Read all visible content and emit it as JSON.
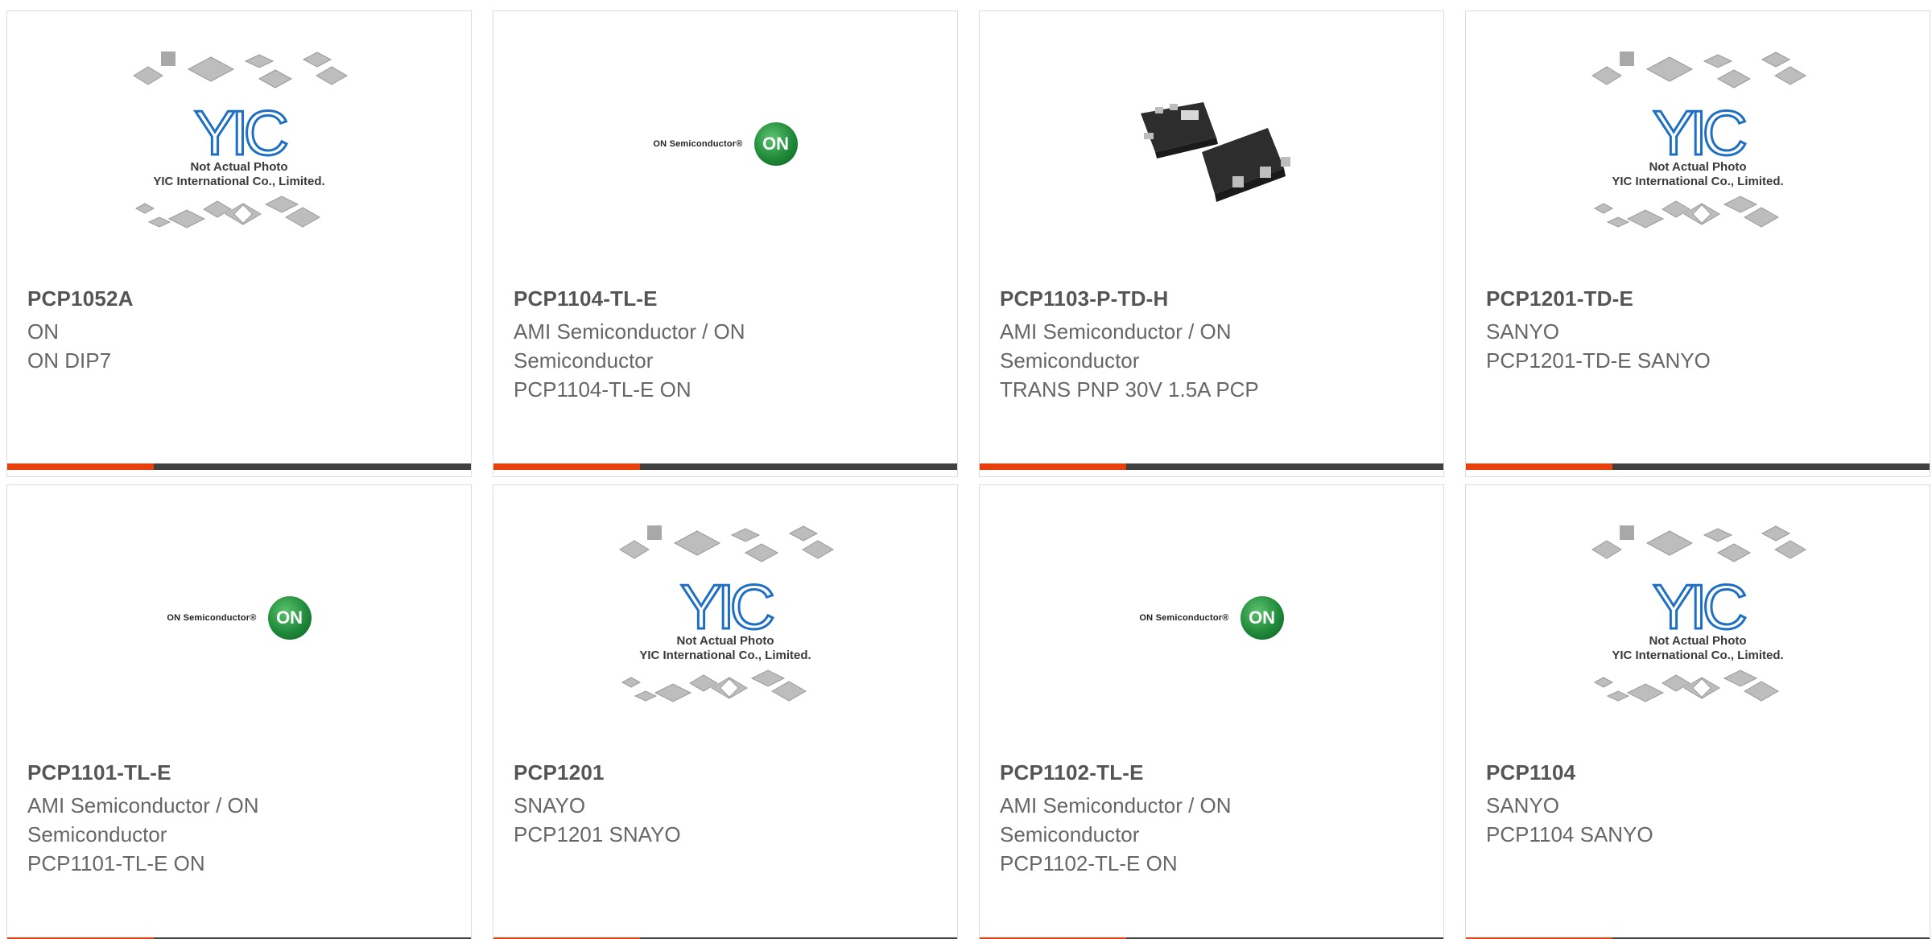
{
  "products": [
    {
      "part": "PCP1052A",
      "manufacturer": "ON",
      "description": "ON DIP7",
      "image": "yic-placeholder-icon"
    },
    {
      "part": "PCP1104-TL-E",
      "manufacturer": "AMI Semiconductor / ON Semiconductor",
      "description": "PCP1104-TL-E ON",
      "image": "on-semiconductor-logo"
    },
    {
      "part": "PCP1103-P-TD-H",
      "manufacturer": "AMI Semiconductor / ON Semiconductor",
      "description": "TRANS PNP 30V 1.5A PCP",
      "image": "transistor-photo"
    },
    {
      "part": "PCP1201-TD-E",
      "manufacturer": "SANYO",
      "description": "PCP1201-TD-E SANYO",
      "image": "yic-placeholder-icon"
    },
    {
      "part": "PCP1101-TL-E",
      "manufacturer": "AMI Semiconductor / ON Semiconductor",
      "description": "PCP1101-TL-E ON",
      "image": "on-semiconductor-logo"
    },
    {
      "part": "PCP1201",
      "manufacturer": "SNAYO",
      "description": "PCP1201 SNAYO",
      "image": "yic-placeholder-icon"
    },
    {
      "part": "PCP1102-TL-E",
      "manufacturer": "AMI Semiconductor / ON Semiconductor",
      "description": "PCP1102-TL-E ON",
      "image": "on-semiconductor-logo"
    },
    {
      "part": "PCP1104",
      "manufacturer": "SANYO",
      "description": "PCP1104 SANYO",
      "image": "yic-placeholder-icon"
    }
  ],
  "placeholder": {
    "line1": "Not Actual Photo",
    "line2": "YIC International Co., Limited.",
    "logo": "YIC"
  },
  "on_logo": {
    "text": "ON Semiconductor®",
    "ball": "ON"
  },
  "colors": {
    "accent": "#e8400c",
    "bar": "#404040",
    "part_text": "#555555",
    "body_text": "#666666",
    "on_green": "#1f8a3a",
    "yic_blue": "#1e6fc4"
  }
}
